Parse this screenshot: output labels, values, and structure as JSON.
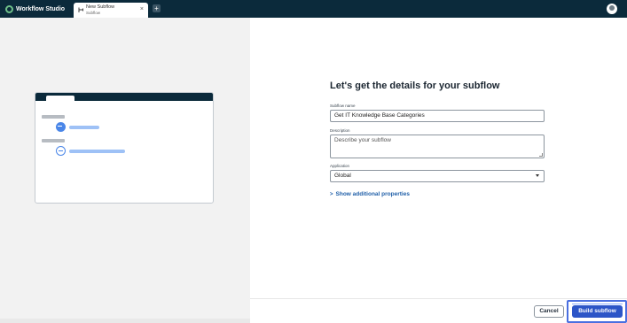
{
  "app": {
    "title": "Workflow Studio"
  },
  "tabs": [
    {
      "title": "New Subflow",
      "subtitle": "Subflow"
    }
  ],
  "form": {
    "heading": "Let's get the details for your subflow",
    "name_label": "Subflow name",
    "name_value": "Get IT Knowledge Base Categories",
    "description_label": "Description",
    "description_placeholder": "Describe your subflow",
    "application_label": "Application",
    "application_value": "Global",
    "show_props": "Show additional properties"
  },
  "footer": {
    "cancel_label": "Cancel",
    "build_label": "Build subflow"
  },
  "colors": {
    "topbar": "#0b2a3b",
    "accent": "#2c55c7",
    "link": "#1f5fa8"
  },
  "icons": {
    "brand": "workflow-logo-icon",
    "tab": "subflow-icon",
    "close": "close-icon",
    "add_tab": "plus-icon",
    "avatar": "user-avatar-icon",
    "select": "chevron-down-icon",
    "expand": "chevron-right-icon"
  }
}
